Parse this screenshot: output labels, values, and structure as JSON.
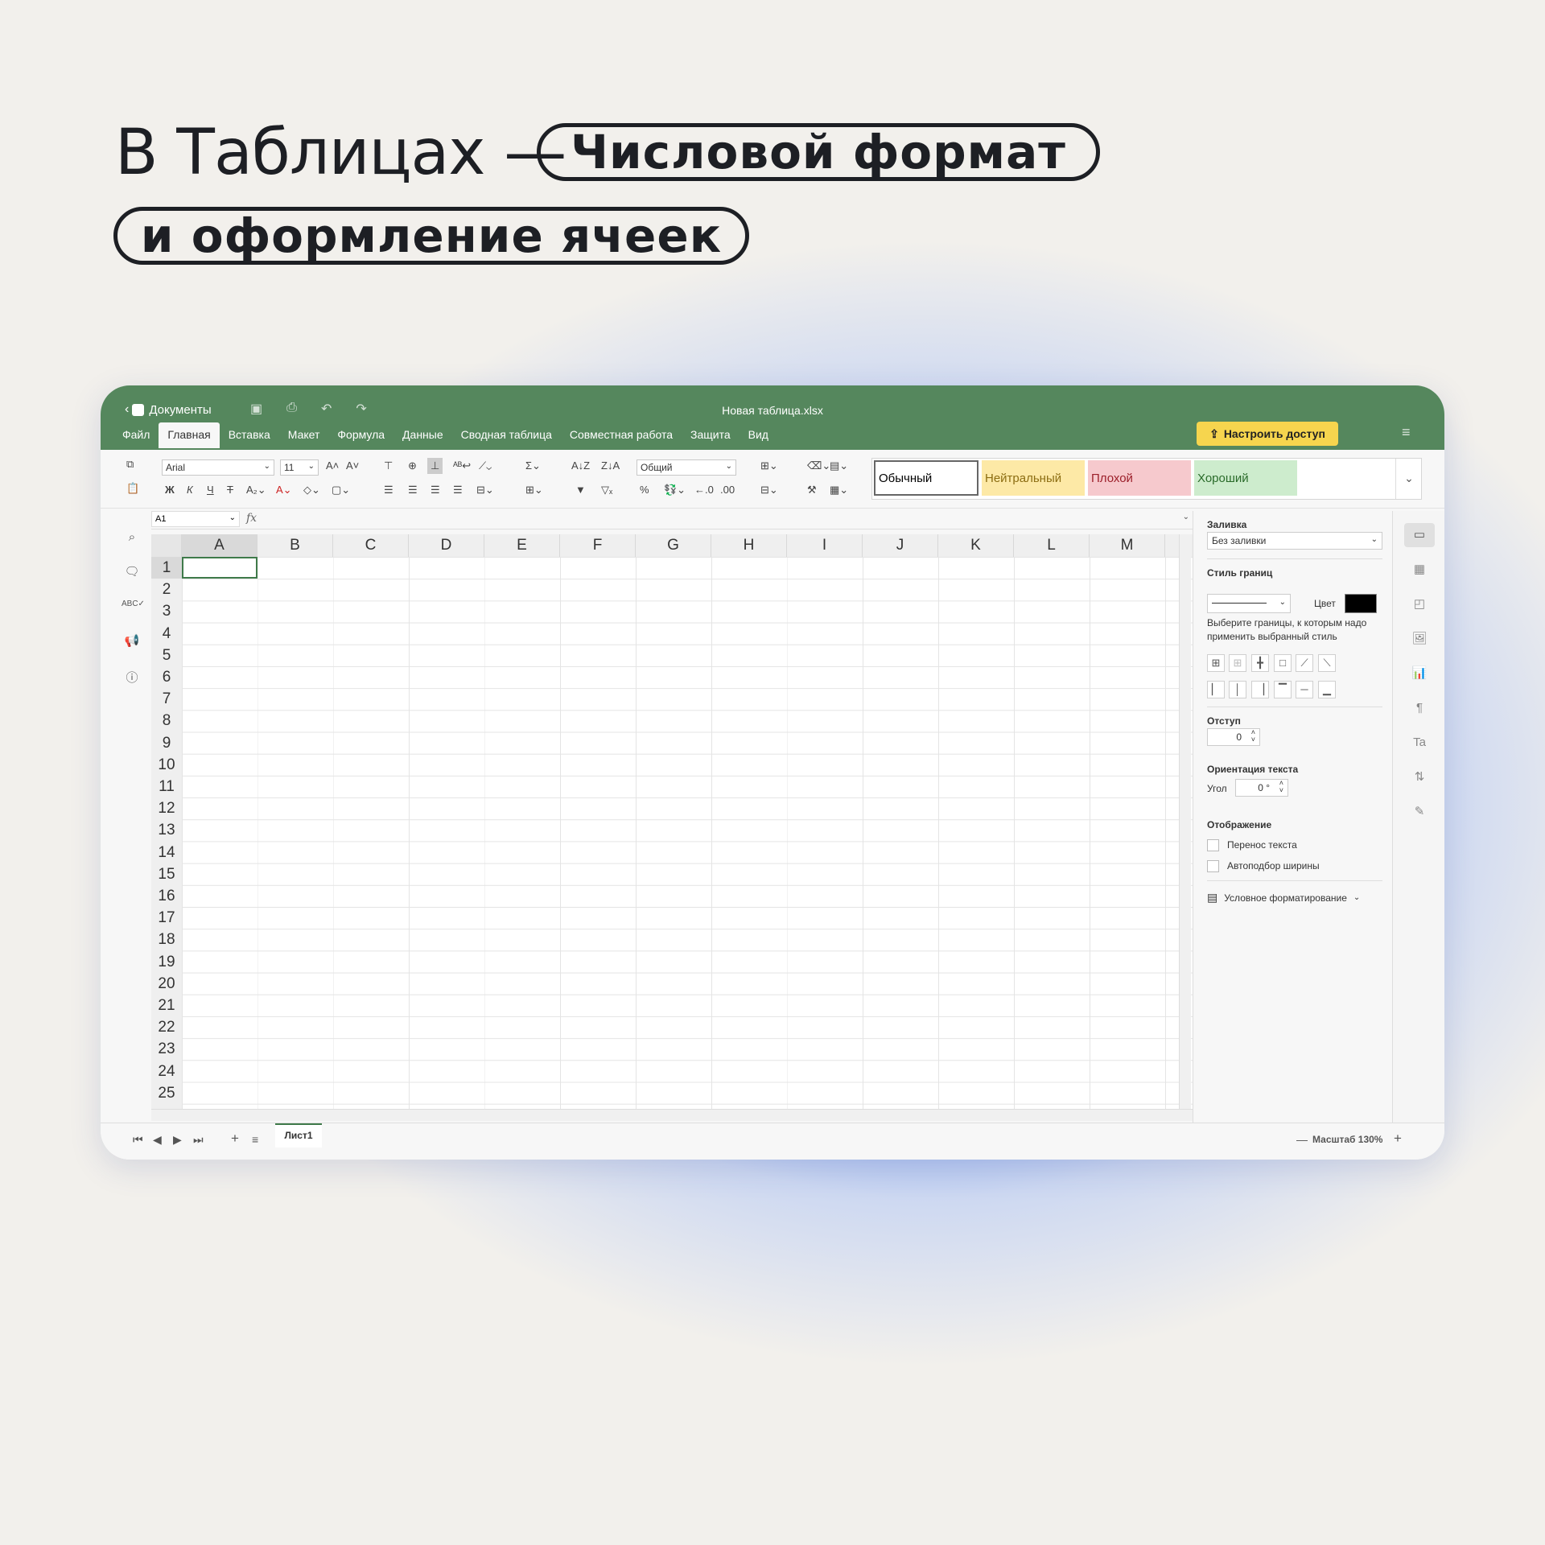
{
  "headline": {
    "line1": "В Таблицах —",
    "pill1": "Числовой формат",
    "pill2": "и оформление ячеек"
  },
  "app": {
    "back_label": "Документы",
    "file_title": "Новая таблица.xlsx",
    "menu": [
      "Файл",
      "Главная",
      "Вставка",
      "Макет",
      "Формула",
      "Данные",
      "Сводная таблица",
      "Совместная работа",
      "Защита",
      "Вид"
    ],
    "active_menu": "Главная",
    "share_button": "Настроить доступ"
  },
  "ribbon": {
    "font_name": "Arial",
    "font_size": "11",
    "number_format": "Общий",
    "bold": "Ж",
    "italic": "К",
    "underline": "Ч",
    "strike": "Т",
    "cell_styles": [
      {
        "label": "Обычный",
        "bg": "#ffffff",
        "color": "#000000"
      },
      {
        "label": "Нейтральный",
        "bg": "#fde9a6",
        "color": "#8c6d12"
      },
      {
        "label": "Плохой",
        "bg": "#f6c9cd",
        "color": "#9c1f2a"
      },
      {
        "label": "Хороший",
        "bg": "#cdeccd",
        "color": "#2a6b2a"
      }
    ]
  },
  "formula_bar": {
    "name_box": "A1",
    "fx": "fx",
    "formula": ""
  },
  "grid": {
    "columns": [
      "A",
      "B",
      "C",
      "D",
      "E",
      "F",
      "G",
      "H",
      "I",
      "J",
      "K",
      "L",
      "M"
    ],
    "rows": [
      "1",
      "2",
      "3",
      "4",
      "5",
      "6",
      "7",
      "8",
      "9",
      "10",
      "11",
      "12",
      "13",
      "14",
      "15",
      "16",
      "17",
      "18",
      "19",
      "20",
      "21",
      "22",
      "23",
      "24",
      "25"
    ],
    "active_cell": "A1"
  },
  "panel": {
    "fill_label": "Заливка",
    "fill_value": "Без заливки",
    "border_style_label": "Стиль границ",
    "color_label": "Цвет",
    "border_hint": "Выберите границы, к которым надо применить выбранный стиль",
    "indent_label": "Отступ",
    "indent_value": "0",
    "orientation_label": "Ориентация текста",
    "angle_label": "Угол",
    "angle_value": "0 °",
    "display_label": "Отображение",
    "wrap_text": "Перенос текста",
    "autofit": "Автоподбор ширины",
    "conditional": "Условное форматирование",
    "border_color": "#000000"
  },
  "statusbar": {
    "sheet_tab": "Лист1",
    "zoom_label": "Масштаб 130%"
  },
  "colors": {
    "topbar": "#55875d",
    "accent_button": "#f6d54e",
    "active_cell": "#3f7a4a"
  }
}
